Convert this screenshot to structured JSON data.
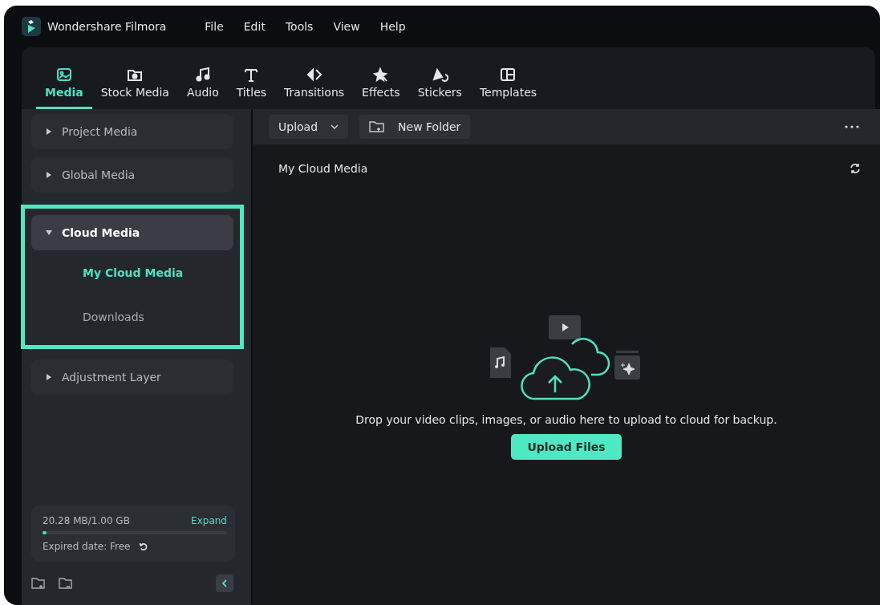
{
  "app": {
    "title": "Wondershare Filmora"
  },
  "menu": [
    "File",
    "Edit",
    "Tools",
    "View",
    "Help"
  ],
  "tabs": [
    {
      "label": "Media",
      "kind": "media",
      "selected": true
    },
    {
      "label": "Stock Media",
      "kind": "stock",
      "selected": false
    },
    {
      "label": "Audio",
      "kind": "audio",
      "selected": false
    },
    {
      "label": "Titles",
      "kind": "titles",
      "selected": false
    },
    {
      "label": "Transitions",
      "kind": "transitions",
      "selected": false
    },
    {
      "label": "Effects",
      "kind": "effects",
      "selected": false
    },
    {
      "label": "Stickers",
      "kind": "stickers",
      "selected": false
    },
    {
      "label": "Templates",
      "kind": "templates",
      "selected": false
    }
  ],
  "sidebar": {
    "items": [
      {
        "label": "Project Media",
        "expanded": false,
        "highlighted": false
      },
      {
        "label": "Global Media",
        "expanded": false,
        "highlighted": false
      },
      {
        "label": "Cloud Media",
        "expanded": true,
        "highlighted": true,
        "children": [
          {
            "label": "My Cloud Media",
            "selected": true
          },
          {
            "label": "Downloads",
            "selected": false
          }
        ]
      },
      {
        "label": "Adjustment Layer",
        "expanded": false,
        "highlighted": false
      }
    ],
    "storage": {
      "usage": "20.28 MB/1.00 GB",
      "action": "Expand",
      "level": 0.02,
      "expiry": "Expired date: Free"
    }
  },
  "toolbar": {
    "upload": "Upload",
    "new_folder": "New Folder"
  },
  "content": {
    "title": "My Cloud Media",
    "message": "Drop your video clips, images, or audio here to upload to cloud for backup.",
    "button": "Upload Files"
  }
}
